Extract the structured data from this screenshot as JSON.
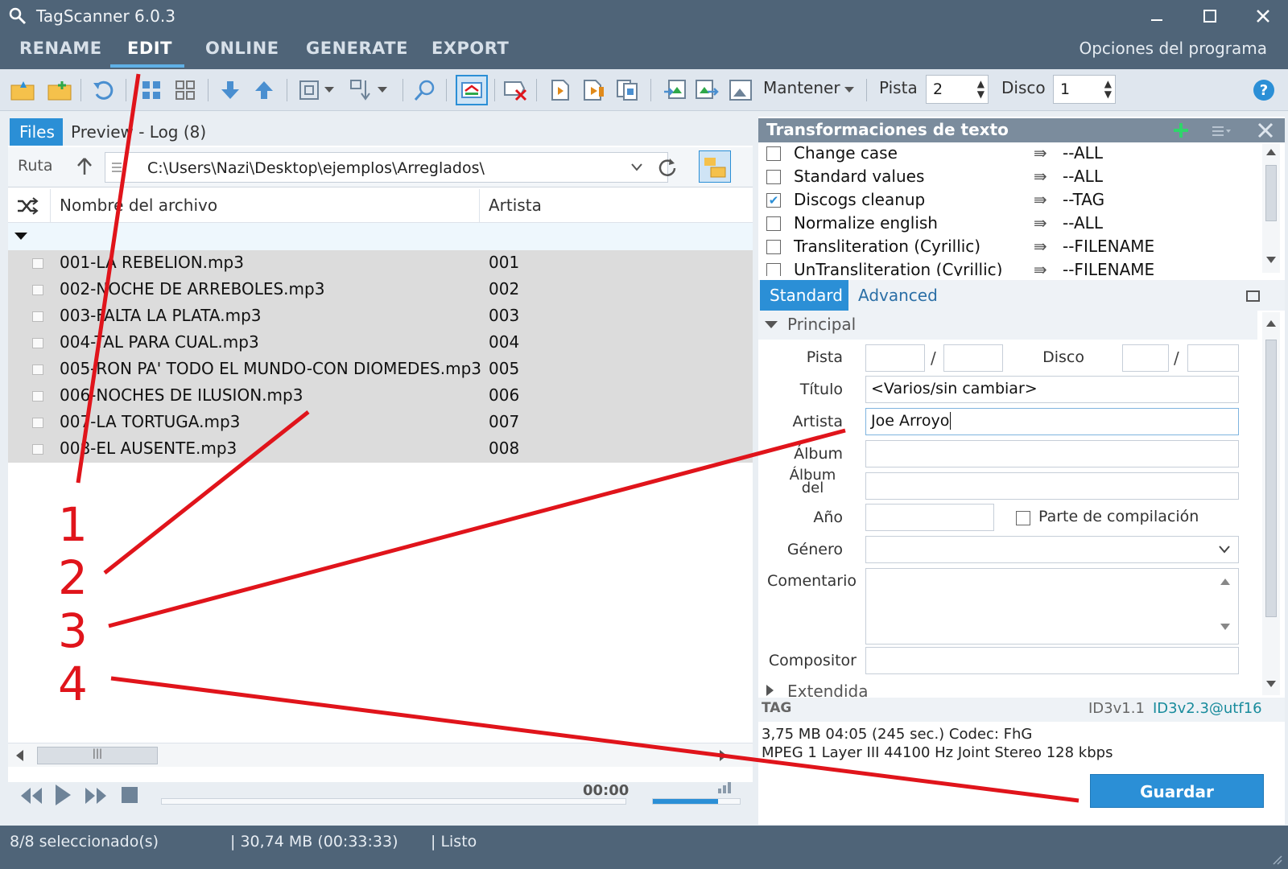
{
  "app": {
    "title": "TagScanner 6.0.3"
  },
  "menu": {
    "items": [
      "RENAME",
      "EDIT",
      "ONLINE",
      "GENERATE",
      "EXPORT"
    ],
    "options_label": "Opciones del programa"
  },
  "toolbar": {
    "keep_label": "Mantener",
    "track_label": "Pista",
    "track_value": "2",
    "disc_label": "Disco",
    "disc_value": "1"
  },
  "left_tabs": {
    "files": "Files",
    "preview_log": "Preview - Log (8)"
  },
  "path": {
    "label": "Ruta",
    "value": "C:\\Users\\Nazi\\Desktop\\ejemplos\\Arreglados\\"
  },
  "columns": {
    "filename": "Nombre del archivo",
    "artist": "Artista"
  },
  "files": [
    {
      "name": "001-LA REBELION.mp3",
      "artist": "001"
    },
    {
      "name": "002-NOCHE DE ARREBOLES.mp3",
      "artist": "002"
    },
    {
      "name": "003-FALTA LA PLATA.mp3",
      "artist": "003"
    },
    {
      "name": "004-TAL PARA CUAL.mp3",
      "artist": "004"
    },
    {
      "name": "005-RON PA' TODO EL MUNDO-CON DIOMEDES.mp3",
      "artist": "005"
    },
    {
      "name": "006-NOCHES DE ILUSION.mp3",
      "artist": "006"
    },
    {
      "name": "007-LA TORTUGA.mp3",
      "artist": "007"
    },
    {
      "name": "008-EL AUSENTE.mp3",
      "artist": "008"
    }
  ],
  "player": {
    "time": "00:00",
    "progress": 0,
    "volume": 0.75
  },
  "transformations": {
    "title": "Transformaciones de texto",
    "items": [
      {
        "name": "Change case",
        "scope": "--ALL",
        "checked": false
      },
      {
        "name": "Standard values",
        "scope": "--ALL",
        "checked": false
      },
      {
        "name": "Discogs cleanup",
        "scope": "--TAG",
        "checked": true
      },
      {
        "name": "Normalize english",
        "scope": "--ALL",
        "checked": false
      },
      {
        "name": "Transliteration (Cyrillic)",
        "scope": "--FILENAME",
        "checked": false
      },
      {
        "name": "UnTransliteration (Cyrillic)",
        "scope": "--FILENAME",
        "checked": false
      }
    ]
  },
  "editor": {
    "tab_standard": "Standard",
    "tab_advanced": "Advanced",
    "section_principal": "Principal",
    "section_extended": "Extendida",
    "labels": {
      "track": "Pista",
      "disc": "Disco",
      "title": "Título",
      "artist": "Artista",
      "album": "Álbum",
      "album_artist": "Álbum del",
      "year": "Año",
      "compilation": "Parte de compilación",
      "genre": "Género",
      "comment": "Comentario",
      "composer": "Compositor"
    },
    "values": {
      "title": "<Varios/sin cambiar>",
      "artist": "Joe Arroyo"
    },
    "slash": "/"
  },
  "tag": {
    "label": "TAG",
    "v1": "ID3v1.1",
    "v2": "ID3v2.3@utf16",
    "info1": "3,75 MB  04:05 (245 sec.)  Codec: FhG",
    "info2": "MPEG 1 Layer III  44100 Hz  Joint Stereo  128 kbps"
  },
  "save_label": "Guardar",
  "status": {
    "selected": "8/8 seleccionado(s)",
    "size": "| 30,74 MB (00:33:33)",
    "state": "| Listo"
  },
  "annotations": [
    "1",
    "2",
    "3",
    "4"
  ],
  "colors": {
    "accent": "#2b8fd6",
    "chrome": "#4f6478",
    "annotation": "#e0141b"
  }
}
